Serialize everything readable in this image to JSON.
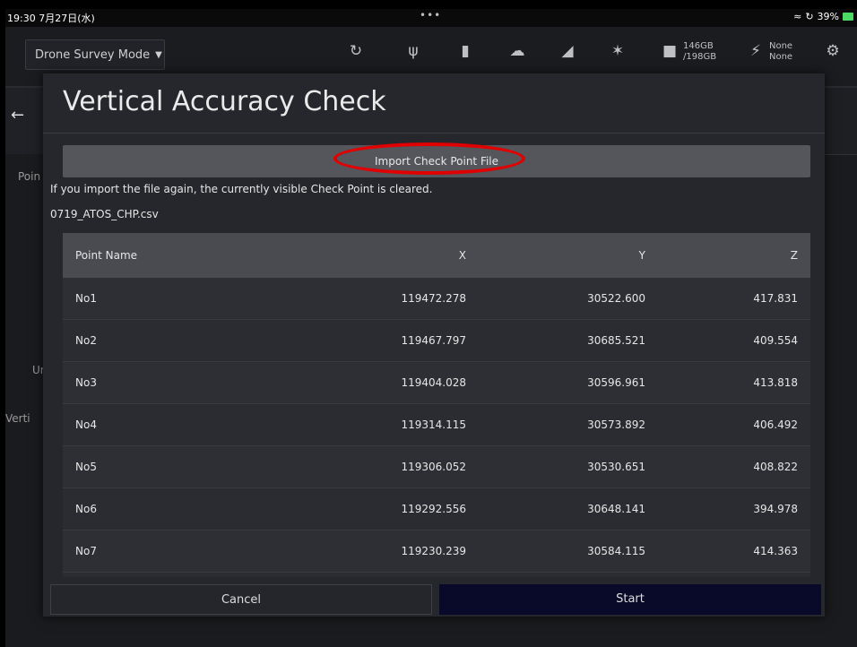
{
  "status": {
    "time": "19:30  7月27日(水)",
    "battery": "39%"
  },
  "toolbar": {
    "mode": "Drone Survey Mode",
    "storage_used": "146GB",
    "storage_total": "/198GB",
    "power_top": "None",
    "power_bottom": "None"
  },
  "background": {
    "point": "Poin",
    "un": "Ur",
    "vert": "Verti"
  },
  "dialog": {
    "title": "Vertical Accuracy Check",
    "import_label": "Import Check Point File",
    "warning": "If you import the file again, the currently visible Check Point is cleared.",
    "filename": "0719_ATOS_CHP.csv",
    "columns": [
      "Point Name",
      "X",
      "Y",
      "Z"
    ],
    "rows": [
      [
        "No1",
        "119472.278",
        "30522.600",
        "417.831"
      ],
      [
        "No2",
        "119467.797",
        "30685.521",
        "409.554"
      ],
      [
        "No3",
        "119404.028",
        "30596.961",
        "413.818"
      ],
      [
        "No4",
        "119314.115",
        "30573.892",
        "406.492"
      ],
      [
        "No5",
        "119306.052",
        "30530.651",
        "408.822"
      ],
      [
        "No6",
        "119292.556",
        "30648.141",
        "394.978"
      ],
      [
        "No7",
        "119230.239",
        "30584.115",
        "414.363"
      ]
    ],
    "cancel_label": "Cancel",
    "start_label": "Start"
  },
  "colors": {
    "accent_ellipse": "#e00000",
    "start_bg": "#09092a",
    "battery": "#4cd964"
  }
}
